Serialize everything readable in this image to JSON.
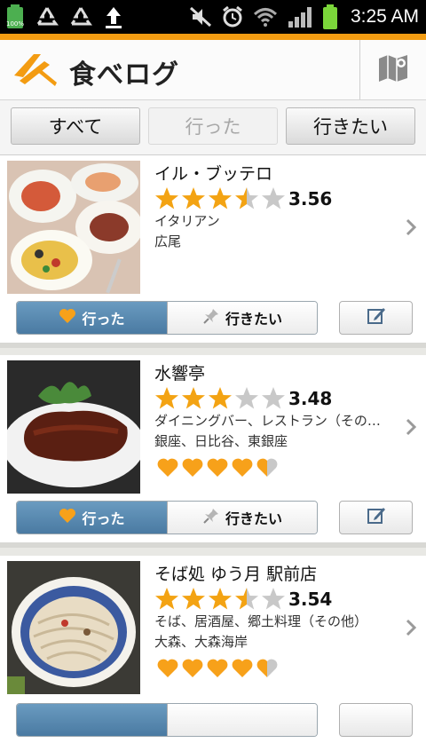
{
  "status_bar": {
    "battery_percent": "100%",
    "time": "3:25 AM",
    "icons": [
      "battery-icon",
      "recycle-icon",
      "recycle-icon",
      "upload-icon",
      "mute-icon",
      "alarm-icon",
      "wifi-icon",
      "signal-icon",
      "battery-icon"
    ]
  },
  "header": {
    "logo_text": "食べログ",
    "map_icon": "map-icon"
  },
  "filters": {
    "all": "すべて",
    "been": "行った",
    "want": "行きたい"
  },
  "restaurants": [
    {
      "name": "イル・ブッテロ",
      "rating": 3.56,
      "rating_text": "3.56",
      "genre": "イタリアン",
      "area": "広尾",
      "visited_label": "行った",
      "want_label": "行きたい",
      "hearts": 0
    },
    {
      "name": "水響亭",
      "rating": 3.48,
      "rating_text": "3.48",
      "genre": "ダイニングバー、レストラン（その…",
      "area": "銀座、日比谷、東銀座",
      "visited_label": "行った",
      "want_label": "行きたい",
      "hearts": 4.5
    },
    {
      "name": "そば処 ゆう月 駅前店",
      "rating": 3.54,
      "rating_text": "3.54",
      "genre": "そば、居酒屋、郷土料理（その他）",
      "area": "大森、大森海岸",
      "visited_label": "",
      "want_label": "",
      "hearts": 4.5
    }
  ],
  "colors": {
    "accent_orange": "#f39c12",
    "star": "#f3a313",
    "heart": "#f7a11a",
    "segment_active": "#5a88ae"
  }
}
